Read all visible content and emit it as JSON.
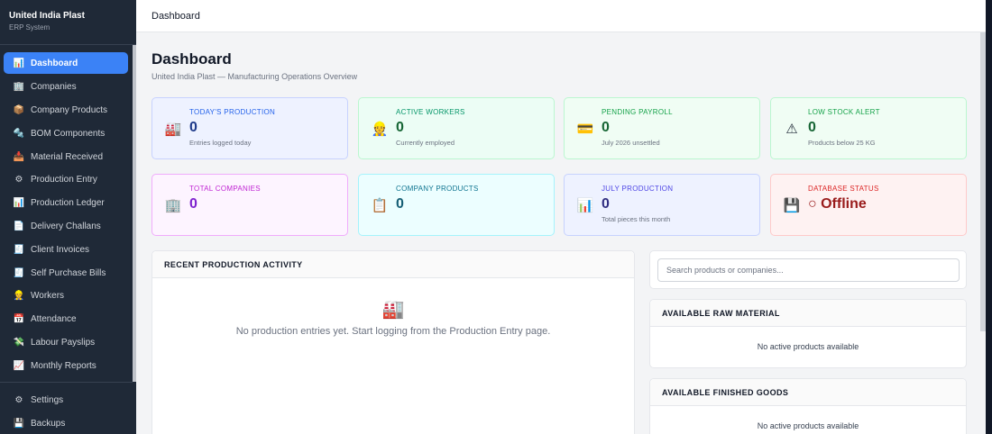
{
  "brand": {
    "title": "United India Plast",
    "subtitle": "ERP System"
  },
  "nav": [
    {
      "label": "Dashboard",
      "icon": "bar-chart-icon",
      "glyph": "📊",
      "active": true
    },
    {
      "label": "Companies",
      "icon": "building-icon",
      "glyph": "🏢"
    },
    {
      "label": "Company Products",
      "icon": "package-icon",
      "glyph": "📦"
    },
    {
      "label": "BOM Components",
      "icon": "tools-icon",
      "glyph": "🔩"
    },
    {
      "label": "Material Received",
      "icon": "inbox-icon",
      "glyph": "📥"
    },
    {
      "label": "Production Entry",
      "icon": "gear-icon",
      "glyph": "⚙"
    },
    {
      "label": "Production Ledger",
      "icon": "ledger-icon",
      "glyph": "📊"
    },
    {
      "label": "Delivery Challans",
      "icon": "document-icon",
      "glyph": "📄"
    },
    {
      "label": "Client Invoices",
      "icon": "receipt-icon",
      "glyph": "🧾"
    },
    {
      "label": "Self Purchase Bills",
      "icon": "bill-icon",
      "glyph": "🧾"
    },
    {
      "label": "Workers",
      "icon": "worker-icon",
      "glyph": "👷"
    },
    {
      "label": "Attendance",
      "icon": "calendar-icon",
      "glyph": "📅"
    },
    {
      "label": "Labour Payslips",
      "icon": "money-icon",
      "glyph": "💸"
    },
    {
      "label": "Monthly Reports",
      "icon": "trend-chart-icon",
      "glyph": "📈"
    }
  ],
  "nav_bottom": [
    {
      "label": "Settings",
      "icon": "gear-icon",
      "glyph": "⚙"
    },
    {
      "label": "Backups",
      "icon": "floppy-icon",
      "glyph": "💾"
    }
  ],
  "topbar": {
    "title": "Dashboard"
  },
  "header": {
    "title": "Dashboard",
    "subtitle": "United India Plast — Manufacturing Operations Overview"
  },
  "cards": [
    {
      "label": "TODAY'S PRODUCTION",
      "value": "0",
      "note": "Entries logged today",
      "icon": "factory-icon",
      "glyph": "🏭",
      "accent": "#2563eb",
      "valueColor": "#1e3a8a",
      "cls": "c-blue"
    },
    {
      "label": "ACTIVE WORKERS",
      "value": "0",
      "note": "Currently employed",
      "icon": "worker-icon",
      "glyph": "👷",
      "accent": "#059669",
      "valueColor": "#166534",
      "cls": "c-green"
    },
    {
      "label": "PENDING PAYROLL",
      "value": "0",
      "note": "July 2026 unsettled",
      "icon": "credit-card-icon",
      "glyph": "💳",
      "accent": "#16a34a",
      "valueColor": "#166534",
      "cls": "c-green2"
    },
    {
      "label": "LOW STOCK ALERT",
      "value": "0",
      "note": "Products below 25 KG",
      "icon": "warning-icon",
      "glyph": "⚠",
      "accent": "#16a34a",
      "valueColor": "#166534",
      "cls": "c-green3"
    },
    {
      "label": "TOTAL COMPANIES",
      "value": "0",
      "note": "",
      "icon": "building-icon",
      "glyph": "🏢",
      "accent": "#c026d3",
      "valueColor": "#7e22ce",
      "cls": "c-purple"
    },
    {
      "label": "COMPANY PRODUCTS",
      "value": "0",
      "note": "",
      "icon": "clipboard-icon",
      "glyph": "📋",
      "accent": "#0e7490",
      "valueColor": "#155e75",
      "cls": "c-cyan"
    },
    {
      "label": "JULY PRODUCTION",
      "value": "0",
      "note": "Total pieces this month",
      "icon": "bar-chart-icon",
      "glyph": "📊",
      "accent": "#4f46e5",
      "valueColor": "#312e81",
      "cls": "c-indigo"
    },
    {
      "label": "DATABASE STATUS",
      "value": "○ Offline",
      "note": "",
      "icon": "floppy-icon",
      "glyph": "💾",
      "accent": "#dc2626",
      "valueColor": "#991b1b",
      "cls": "c-red"
    }
  ],
  "recent": {
    "title": "RECENT PRODUCTION ACTIVITY",
    "empty": "No production entries yet. Start logging from the Production Entry page.",
    "icon": "factory-icon",
    "glyph": "🏭"
  },
  "search": {
    "placeholder": "Search products or companies..."
  },
  "raw": {
    "title": "AVAILABLE RAW MATERIAL",
    "empty": "No active products available"
  },
  "finished": {
    "title": "AVAILABLE FINISHED GOODS",
    "empty": "No active products available"
  }
}
